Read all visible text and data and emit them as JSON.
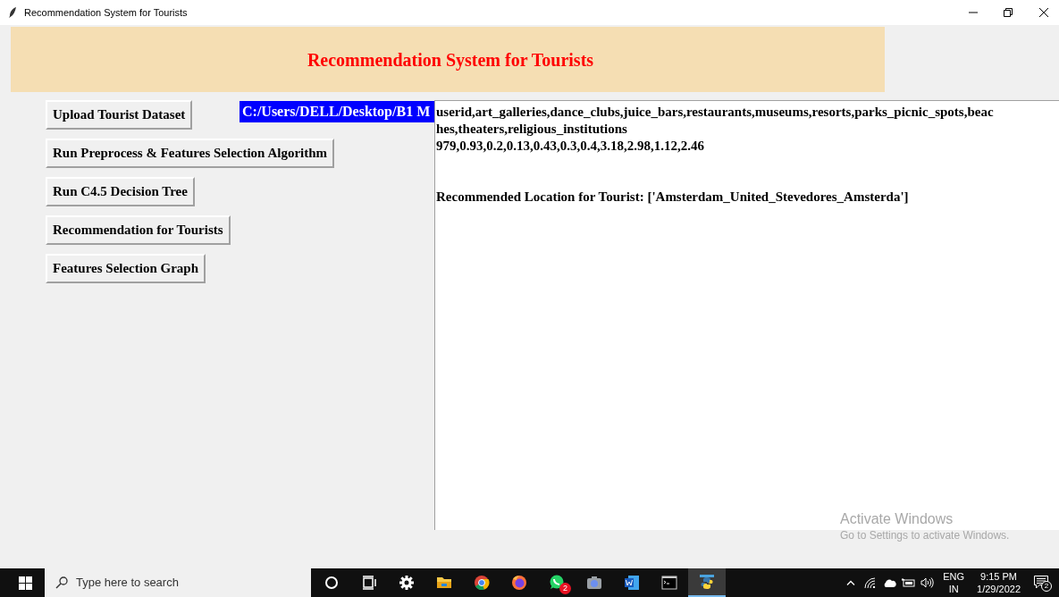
{
  "window": {
    "title": "Recommendation System for Tourists"
  },
  "header": {
    "title": "Recommendation System for Tourists"
  },
  "buttons": [
    "Upload Tourist Dataset",
    "Run Preprocess & Features Selection Algorithm",
    "Run C4.5 Decision Tree",
    "Recommendation for Tourists",
    "Features Selection Graph"
  ],
  "path_label": "C:/Users/DELL/Desktop/B1 M",
  "text_area": {
    "lines": [
      "userid,art_galleries,dance_clubs,juice_bars,restaurants,museums,resorts,parks_picnic_spots,beac",
      "hes,theaters,religious_institutions",
      "979,0.93,0.2,0.13,0.43,0.3,0.4,3.18,2.98,1.12,2.46"
    ],
    "result": "Recommended Location for Tourist: ['Amsterdam_United_Stevedores_Amsterda']"
  },
  "activation_notice": {
    "title": "Activate Windows",
    "subtitle": "Go to Settings to activate Windows."
  },
  "taskbar": {
    "search_placeholder": "Type here to search",
    "apps": [
      {
        "kind": "cortana",
        "selected": false
      },
      {
        "kind": "taskview",
        "selected": false
      },
      {
        "kind": "settings",
        "selected": false
      },
      {
        "kind": "explorer",
        "selected": false
      },
      {
        "kind": "chrome",
        "selected": false
      },
      {
        "kind": "firefox",
        "selected": false
      },
      {
        "kind": "whatsapp",
        "selected": false,
        "badge": "2"
      },
      {
        "kind": "camera",
        "selected": false
      },
      {
        "kind": "word",
        "selected": false
      },
      {
        "kind": "terminal",
        "selected": false
      },
      {
        "kind": "python",
        "selected": true
      }
    ],
    "language": "ENG",
    "region": "IN",
    "time": "9:15 PM",
    "date": "1/29/2022",
    "notification_count": "2"
  }
}
